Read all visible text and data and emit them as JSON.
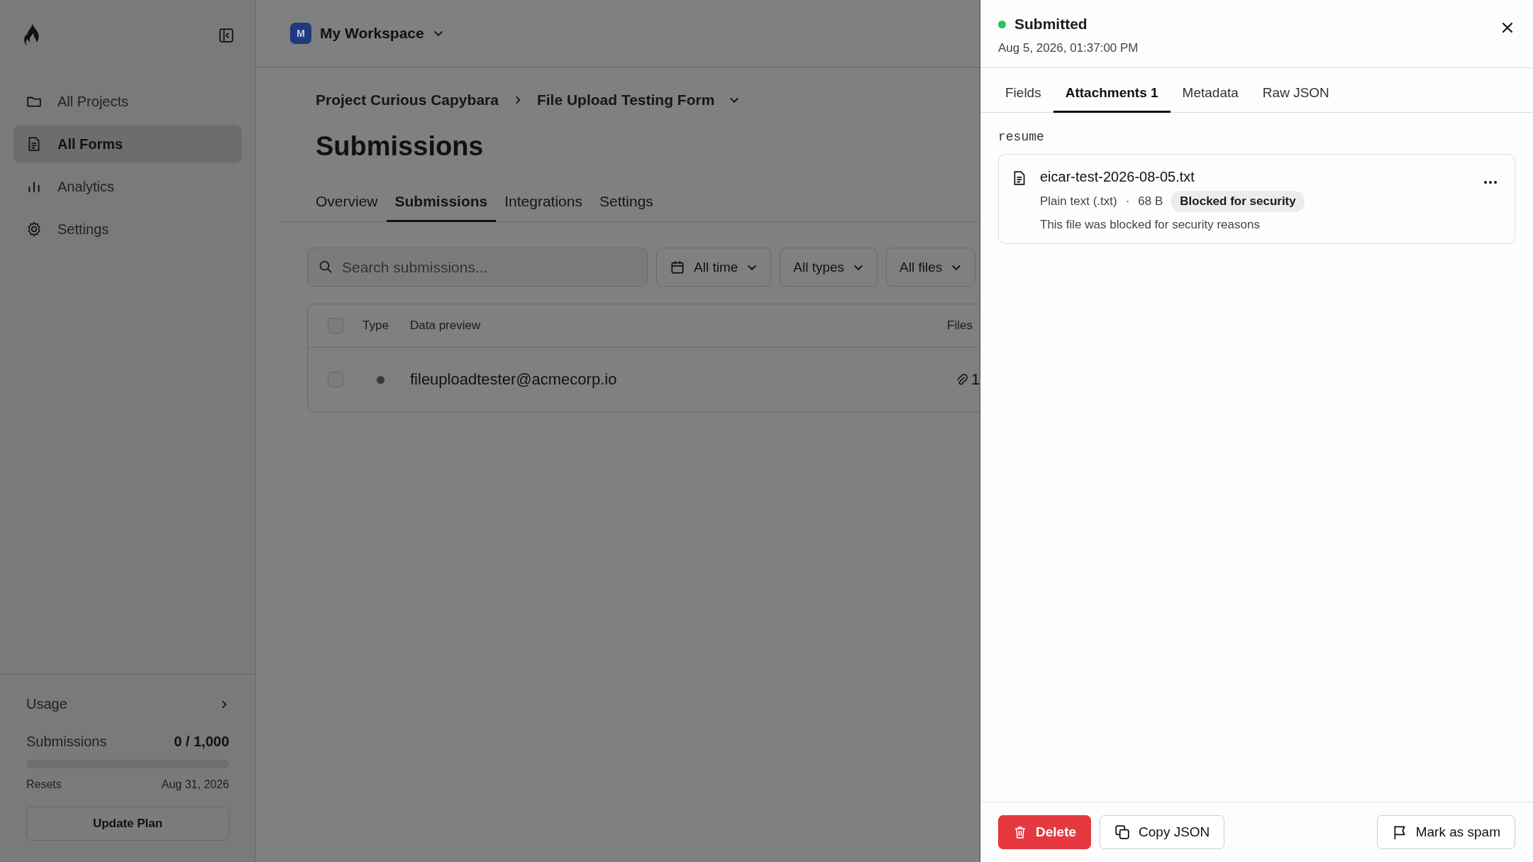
{
  "sidebar": {
    "nav_items": [
      {
        "label": "All Projects",
        "kind": "folder",
        "selected": false
      },
      {
        "label": "All Forms",
        "kind": "file",
        "selected": true
      },
      {
        "label": "Analytics",
        "kind": "chart",
        "selected": false
      },
      {
        "label": "Settings",
        "kind": "gear",
        "selected": false
      }
    ],
    "usage": {
      "title": "Usage",
      "metric": "Submissions",
      "value": "0 / 1,000",
      "level": 0,
      "resets_label": "Resets",
      "resets_date": "Aug 31, 2026",
      "button": "Update Plan"
    }
  },
  "workspace": {
    "initial": "M",
    "name": "My Workspace"
  },
  "breadcrumb": [
    "Project Curious Capybara",
    "File Upload Testing Form"
  ],
  "page_title": "Submissions",
  "tabs": [
    {
      "label": "Overview",
      "selected": false
    },
    {
      "label": "Submissions",
      "selected": true
    },
    {
      "label": "Integrations",
      "selected": false
    },
    {
      "label": "Settings",
      "selected": false
    }
  ],
  "search": {
    "placeholder": "Search submissions..."
  },
  "filters": [
    {
      "label": "All time",
      "kind": "date"
    },
    {
      "label": "All types",
      "kind": "select"
    },
    {
      "label": "All files",
      "kind": "select"
    }
  ],
  "table": {
    "select_all": false,
    "columns": [
      "Type",
      "Data preview",
      "Files"
    ],
    "rows": [
      {
        "checked": false,
        "data_preview": "fileuploadtester@acmecorp.io",
        "files": "1"
      }
    ]
  },
  "panel": {
    "status": "Submitted",
    "date": "Aug 5, 2026, 01:37:00 PM",
    "tabs": [
      {
        "label": "Fields",
        "selected": false
      },
      {
        "label": "Attachments 1",
        "selected": true
      },
      {
        "label": "Metadata",
        "selected": false
      },
      {
        "label": "Raw JSON",
        "selected": false
      }
    ],
    "field_name": "resume",
    "attachments": [
      {
        "file_name": "eicar-test-2026-08-05.txt",
        "file_type": "Plain text (.txt)",
        "separator": "·",
        "size": "68 B",
        "badge": "Blocked for security",
        "note": "This file was blocked for security reasons"
      }
    ],
    "buttons": [
      {
        "label": "Delete",
        "kind": "delete"
      },
      {
        "label": "Copy JSON",
        "kind": "copy"
      },
      {
        "label": "Mark as spam",
        "kind": "spam"
      }
    ]
  }
}
